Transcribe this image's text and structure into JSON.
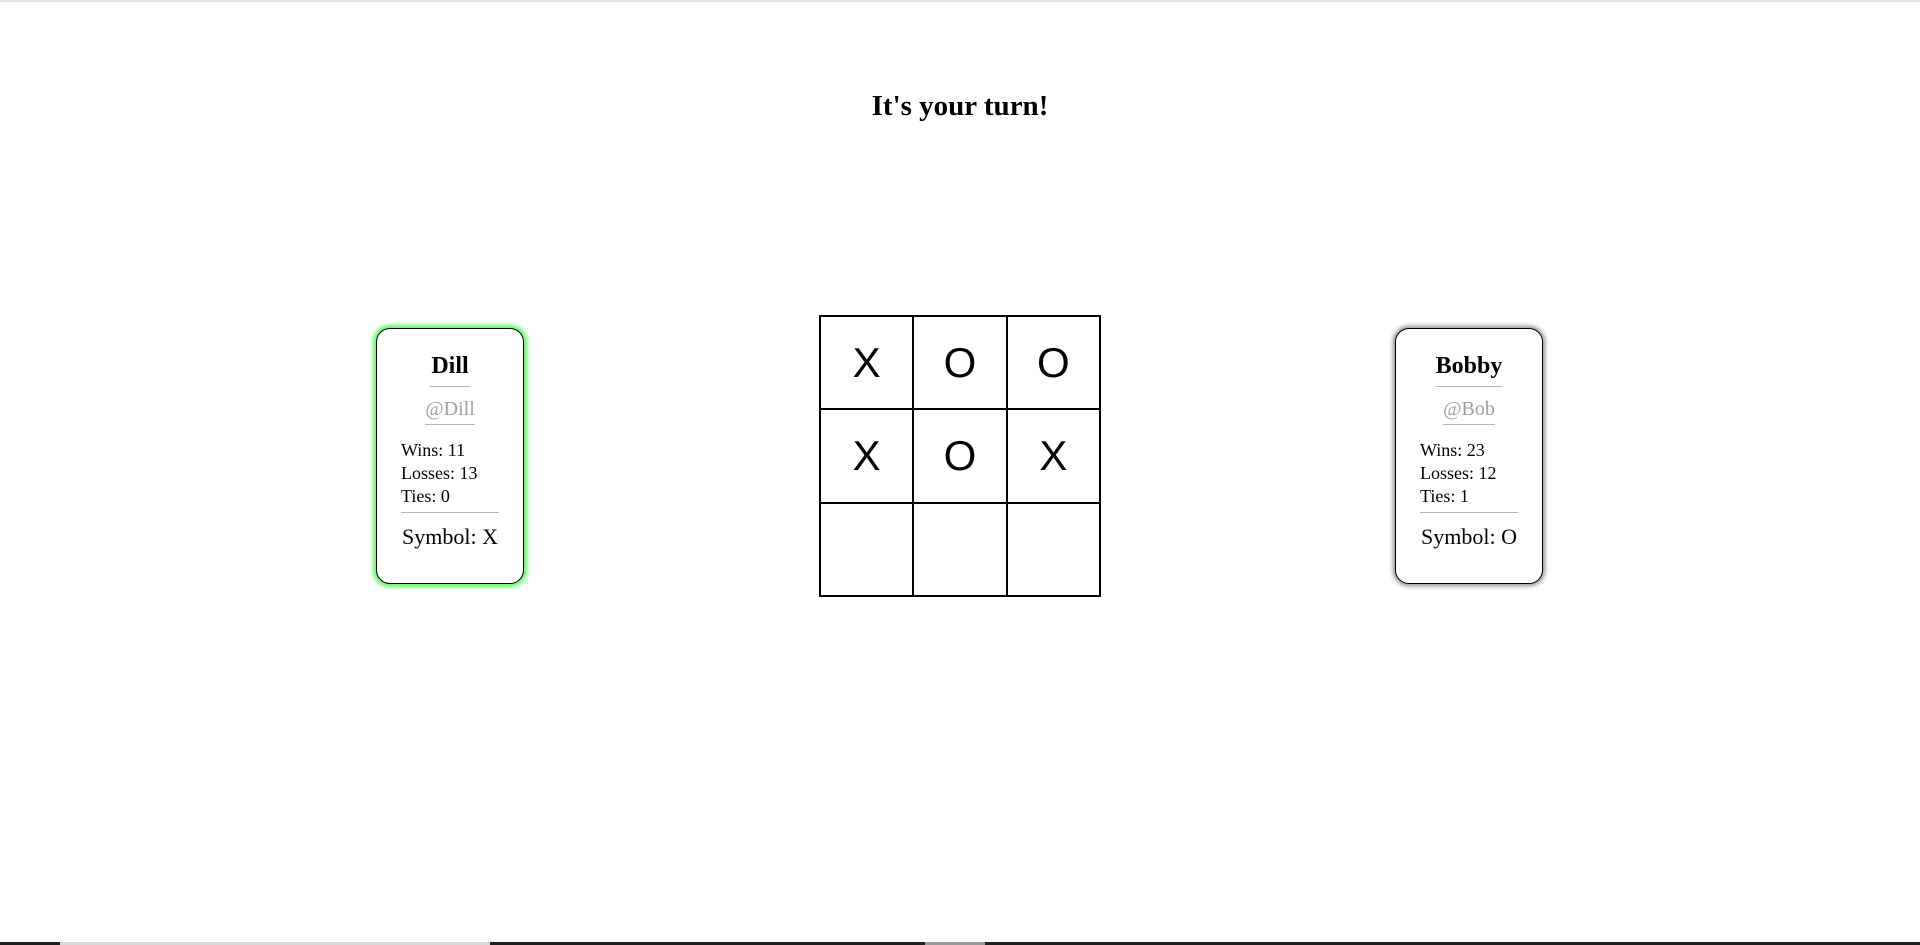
{
  "status": {
    "turn_message": "It's your turn!"
  },
  "players": [
    {
      "name": "Dill",
      "handle": "@Dill",
      "wins": "Wins: 11",
      "losses": "Losses: 13",
      "ties": "Ties: 0",
      "symbol": "Symbol: X",
      "active": true,
      "highlight_color": "#5cf55c"
    },
    {
      "name": "Bobby",
      "handle": "@Bob",
      "wins": "Wins: 23",
      "losses": "Losses: 12",
      "ties": "Ties: 1",
      "symbol": "Symbol: O",
      "active": false,
      "highlight_color": "#8c8c8c"
    }
  ],
  "board": {
    "cells": [
      "X",
      "O",
      "O",
      "X",
      "O",
      "X",
      "",
      "",
      ""
    ]
  }
}
